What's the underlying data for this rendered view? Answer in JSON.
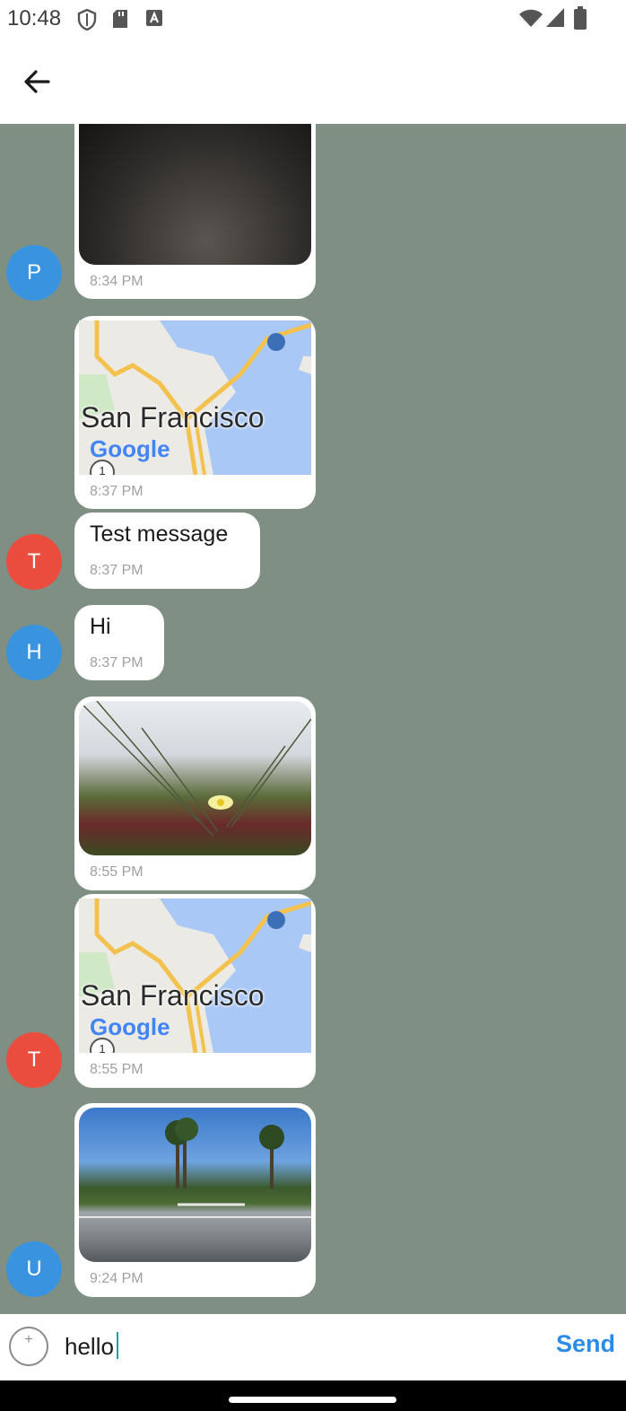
{
  "status_bar": {
    "time": "10:48",
    "icons": [
      "shield-icon",
      "sd-card-icon",
      "font-a-icon",
      "wifi-icon",
      "signal-icon",
      "battery-icon"
    ]
  },
  "app_bar": {
    "back_icon": "arrow-left-icon"
  },
  "messages": [
    {
      "avatar": "P",
      "avatar_color": "#3a93de",
      "type": "image",
      "image": "dark-photo",
      "time": "8:34 PM"
    },
    {
      "avatar": "",
      "type": "map",
      "map_label": "San Francisco",
      "map_logo": "Google",
      "map_marker": "1",
      "time": "8:37 PM"
    },
    {
      "avatar": "T",
      "avatar_color": "#ea4d3d",
      "type": "text",
      "text": "Test message",
      "time": "8:37 PM"
    },
    {
      "avatar": "H",
      "avatar_color": "#3a93de",
      "type": "text",
      "text": "Hi",
      "time": "8:37 PM"
    },
    {
      "avatar": "",
      "type": "image",
      "image": "flower-photo",
      "time": "8:55 PM"
    },
    {
      "avatar": "T",
      "avatar_color": "#ea4d3d",
      "type": "map",
      "map_label": "San Francisco",
      "map_logo": "Google",
      "map_marker": "1",
      "time": "8:55 PM"
    },
    {
      "avatar": "U",
      "avatar_color": "#3a93de",
      "type": "image",
      "image": "palm-trees-photo",
      "time": "9:24 PM"
    }
  ],
  "composer": {
    "attach_symbol": "+",
    "input_value": "hello",
    "send_label": "Send",
    "send_color": "#2a8ce4"
  },
  "colors": {
    "chat_background": "#7f8f84",
    "bubble": "#ffffff"
  }
}
